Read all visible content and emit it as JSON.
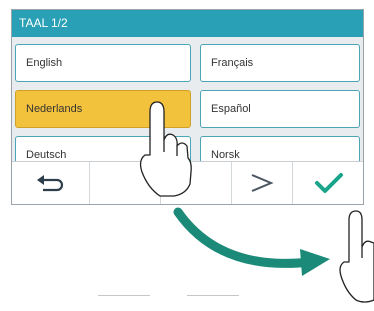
{
  "title": "TAAL 1/2",
  "languages": [
    {
      "label": "English"
    },
    {
      "label": "Français"
    },
    {
      "label": "Nederlands"
    },
    {
      "label": "Español"
    },
    {
      "label": "Deutsch"
    },
    {
      "label": "Norsk"
    }
  ],
  "selected_language": "Nederlands",
  "colors": {
    "title_bar": "#2aa0b6",
    "selected": "#f3c23c",
    "arrow": "#1c8a78",
    "confirm": "#1aa58a"
  },
  "icons": [
    "back-icon",
    "next-icon",
    "confirm-check-icon",
    "pointing-hand-icon",
    "swipe-arrow-icon"
  ]
}
